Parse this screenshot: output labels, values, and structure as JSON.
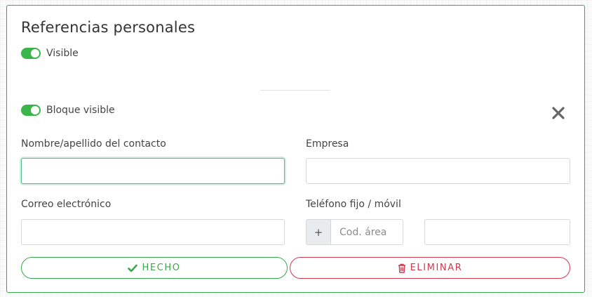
{
  "section": {
    "title": "Referencias personales",
    "visible_label": "Visible"
  },
  "block": {
    "visible_label": "Bloque visible",
    "close_icon": "close-icon"
  },
  "fields": {
    "contact_name": {
      "label": "Nombre/apellido del contacto",
      "value": ""
    },
    "company": {
      "label": "Empresa",
      "value": ""
    },
    "email": {
      "label": "Correo electrónico",
      "value": ""
    },
    "phone": {
      "label": "Teléfono fijo / móvil",
      "prefix": "+",
      "area_placeholder": "Cod. área",
      "number_value": ""
    }
  },
  "actions": {
    "done_label": "HECHO",
    "delete_label": "ELIMINAR"
  },
  "colors": {
    "accent": "#39a84a",
    "toggle_on": "#3ab54a",
    "danger": "#d0394d",
    "close_icon": "#666666"
  }
}
